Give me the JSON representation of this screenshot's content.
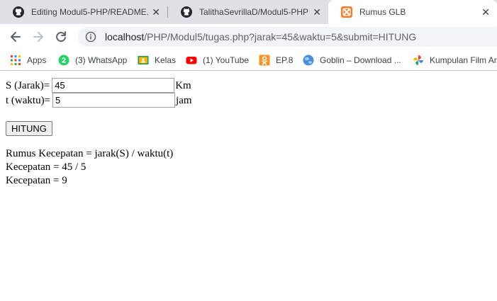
{
  "tabs": [
    {
      "label": "Editing Modul5-PHP/README.",
      "close": "✕",
      "icon": "github-icon",
      "active": false
    },
    {
      "label": "TalithaSevrillaD/Modul5-PHP",
      "close": "✕",
      "icon": "github-icon",
      "active": false
    },
    {
      "label": "Rumus GLB",
      "close": "✕",
      "icon": "xampp-icon",
      "active": true
    }
  ],
  "toolbar": {
    "url_host": "localhost",
    "url_rest": "/PHP/Modul5/tugas.php?jarak=45&waktu=5&submit=HITUNG"
  },
  "bookmarks": [
    {
      "label": "Apps",
      "icon": "apps-grid-icon"
    },
    {
      "label": "(3) WhatsApp",
      "icon": "whatsapp-icon"
    },
    {
      "label": "Kelas",
      "icon": "classroom-icon"
    },
    {
      "label": "(1) YouTube",
      "icon": "youtube-icon"
    },
    {
      "label": "EP.8",
      "icon": "ok-icon"
    },
    {
      "label": "Goblin – Download ...",
      "icon": "globe-icon"
    },
    {
      "label": "Kumpulan Film An",
      "icon": "pinwheel-icon"
    }
  ],
  "form": {
    "jarak_label": "S (Jarak)=",
    "jarak_value": "45",
    "jarak_unit": "Km",
    "waktu_label": "t (waktu)=",
    "waktu_value": "5",
    "waktu_unit": "jam",
    "submit_label": "HITUNG"
  },
  "result": {
    "formula": "Rumus Kecepatan = jarak(S) / waktu(t)",
    "substitution": "Kecepatan = 45 / 5",
    "answer": "Kecepatan = 9"
  }
}
